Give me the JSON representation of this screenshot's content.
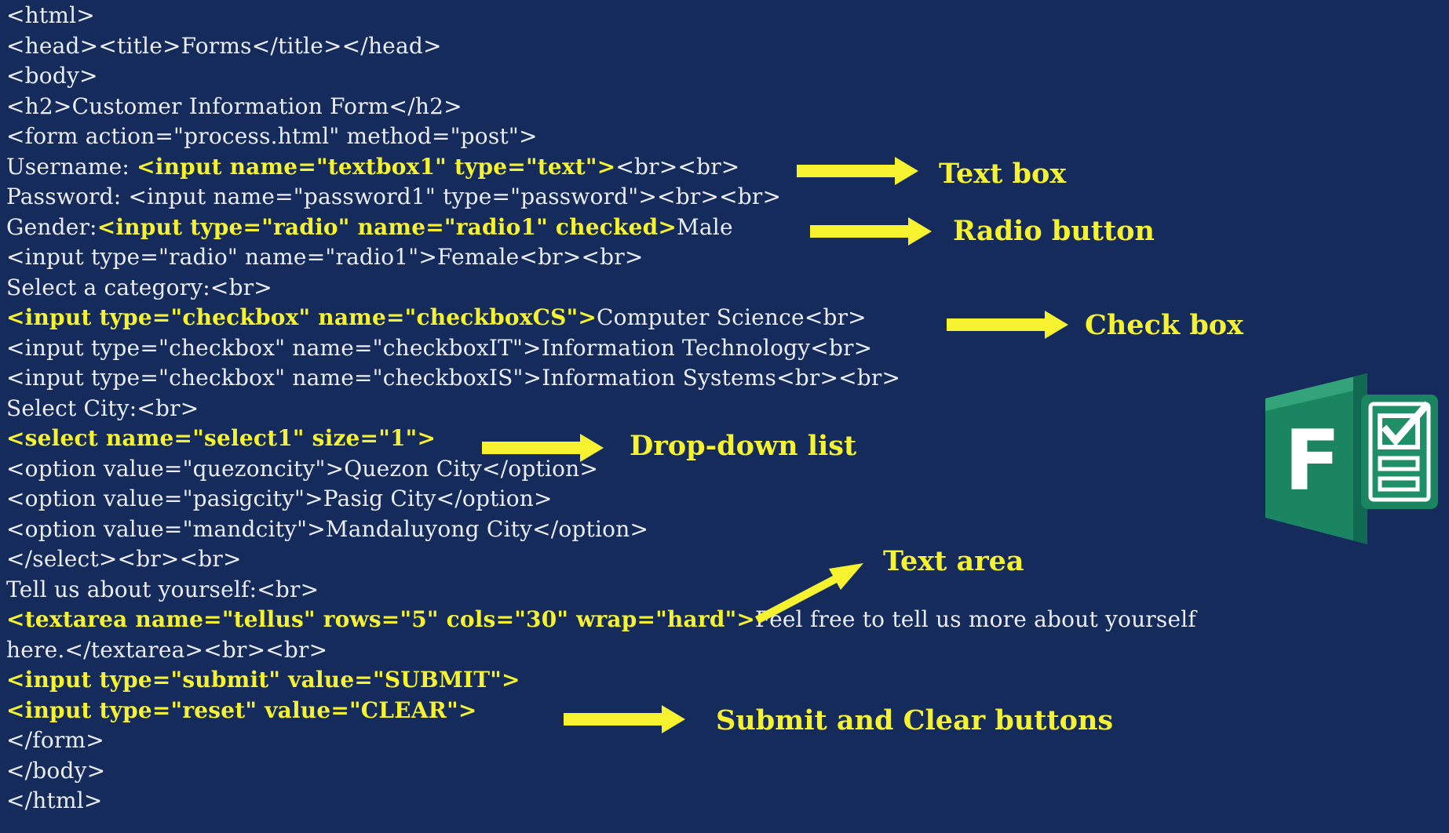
{
  "code": {
    "lines": [
      [
        {
          "t": "<html>"
        }
      ],
      [
        {
          "t": "<head><title>Forms</title></head>"
        }
      ],
      [
        {
          "t": "<body>"
        }
      ],
      [
        {
          "t": "<h2>Customer Information Form</h2>"
        }
      ],
      [
        {
          "t": "<form action=\"process.html\" method=\"post\">"
        }
      ],
      [
        {
          "t": "Username: "
        },
        {
          "t": "<input name=\"textbox1\" type=\"text\">",
          "hl": true
        },
        {
          "t": "<br><br>"
        }
      ],
      [
        {
          "t": "Password: <input name=\"password1\" type=\"password\"><br><br>"
        }
      ],
      [
        {
          "t": "Gender:"
        },
        {
          "t": "<input type=\"radio\" name=\"radio1\" checked>",
          "hl": true
        },
        {
          "t": "Male"
        }
      ],
      [
        {
          "t": "<input type=\"radio\" name=\"radio1\">Female<br><br>"
        }
      ],
      [
        {
          "t": "Select a category:<br>"
        }
      ],
      [
        {
          "t": "<input type=\"checkbox\" name=\"checkboxCS\">",
          "hl": true
        },
        {
          "t": "Computer Science<br>"
        }
      ],
      [
        {
          "t": "<input type=\"checkbox\" name=\"checkboxIT\">Information Technology<br>"
        }
      ],
      [
        {
          "t": "<input type=\"checkbox\" name=\"checkboxIS\">Information Systems<br><br>"
        }
      ],
      [
        {
          "t": "Select City:<br>"
        }
      ],
      [
        {
          "t": "<select name=\"select1\" size=\"1\">",
          "hl": true
        }
      ],
      [
        {
          "t": "<option value=\"quezoncity\">Quezon City</option>"
        }
      ],
      [
        {
          "t": "<option value=\"pasigcity\">Pasig City</option>"
        }
      ],
      [
        {
          "t": "<option value=\"mandcity\">Mandaluyong City</option>"
        }
      ],
      [
        {
          "t": "</select><br><br>"
        }
      ],
      [
        {
          "t": "Tell us about yourself:<br>"
        }
      ],
      [
        {
          "t": "<textarea name=\"tellus\" rows=\"5\" cols=\"30\" wrap=\"hard\">",
          "hl": true
        },
        {
          "t": "Feel free to tell us more about yourself"
        }
      ],
      [
        {
          "t": "here.</textarea><br><br>"
        }
      ],
      [
        {
          "t": "<input type=\"submit\" value=\"SUBMIT\">",
          "hl": true
        }
      ],
      [
        {
          "t": "<input type=\"reset\" value=\"CLEAR\">",
          "hl": true
        }
      ],
      [
        {
          "t": "</form>"
        }
      ],
      [
        {
          "t": "</body>"
        }
      ],
      [
        {
          "t": "</html>"
        }
      ]
    ]
  },
  "callouts": {
    "text_box": "Text box",
    "radio_button": "Radio button",
    "check_box": "Check box",
    "drop_down_list": "Drop-down list",
    "text_area": "Text area",
    "submit_clear": "Submit and Clear buttons"
  },
  "icon": {
    "name": "microsoft-forms-icon",
    "letter": "F",
    "colors": {
      "dark": "#0f6a51",
      "mid": "#1b8461",
      "light": "#33a37a",
      "white": "#ffffff"
    }
  },
  "colors": {
    "background": "#142b5c",
    "code_text": "#ecedf2",
    "highlight": "#f6f230"
  }
}
